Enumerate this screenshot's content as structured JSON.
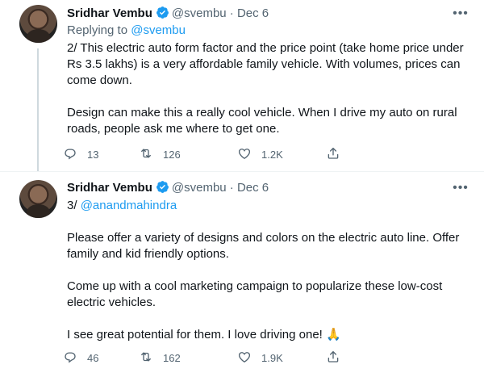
{
  "tweets": [
    {
      "author_name": "Sridhar Vembu",
      "handle": "@svembu",
      "separator": "·",
      "date": "Dec 6",
      "replying_prefix": "Replying to ",
      "replying_to": "@svembu",
      "paragraphs": [
        "2/ This electric auto form factor and the price point (take home price under Rs 3.5 lakhs) is a very affordable family vehicle. With volumes, prices can come down.",
        "Design can make this a really cool vehicle. When I drive my auto on rural roads, people ask me where to get one."
      ],
      "replies": "13",
      "retweets": "126",
      "likes": "1.2K"
    },
    {
      "author_name": "Sridhar Vembu",
      "handle": "@svembu",
      "separator": "·",
      "date": "Dec 6",
      "mention_prefix": "3/ ",
      "mention": "@anandmahindra",
      "paragraphs": [
        "Please offer a variety of designs and colors on the electric auto line. Offer family and kid friendly options.",
        "Come up with a cool marketing campaign to popularize these low-cost electric vehicles.",
        "I see great potential for them. I love driving one! 🙏"
      ],
      "replies": "46",
      "retweets": "162",
      "likes": "1.9K"
    }
  ],
  "icons": {
    "verified": "verified-badge-icon",
    "more": "more-icon",
    "reply": "reply-icon",
    "retweet": "retweet-icon",
    "like": "like-icon",
    "share": "share-icon"
  },
  "colors": {
    "link": "#1d9bf0",
    "secondary_text": "#536471",
    "primary_text": "#0f1419",
    "verified": "#1d9bf0"
  }
}
